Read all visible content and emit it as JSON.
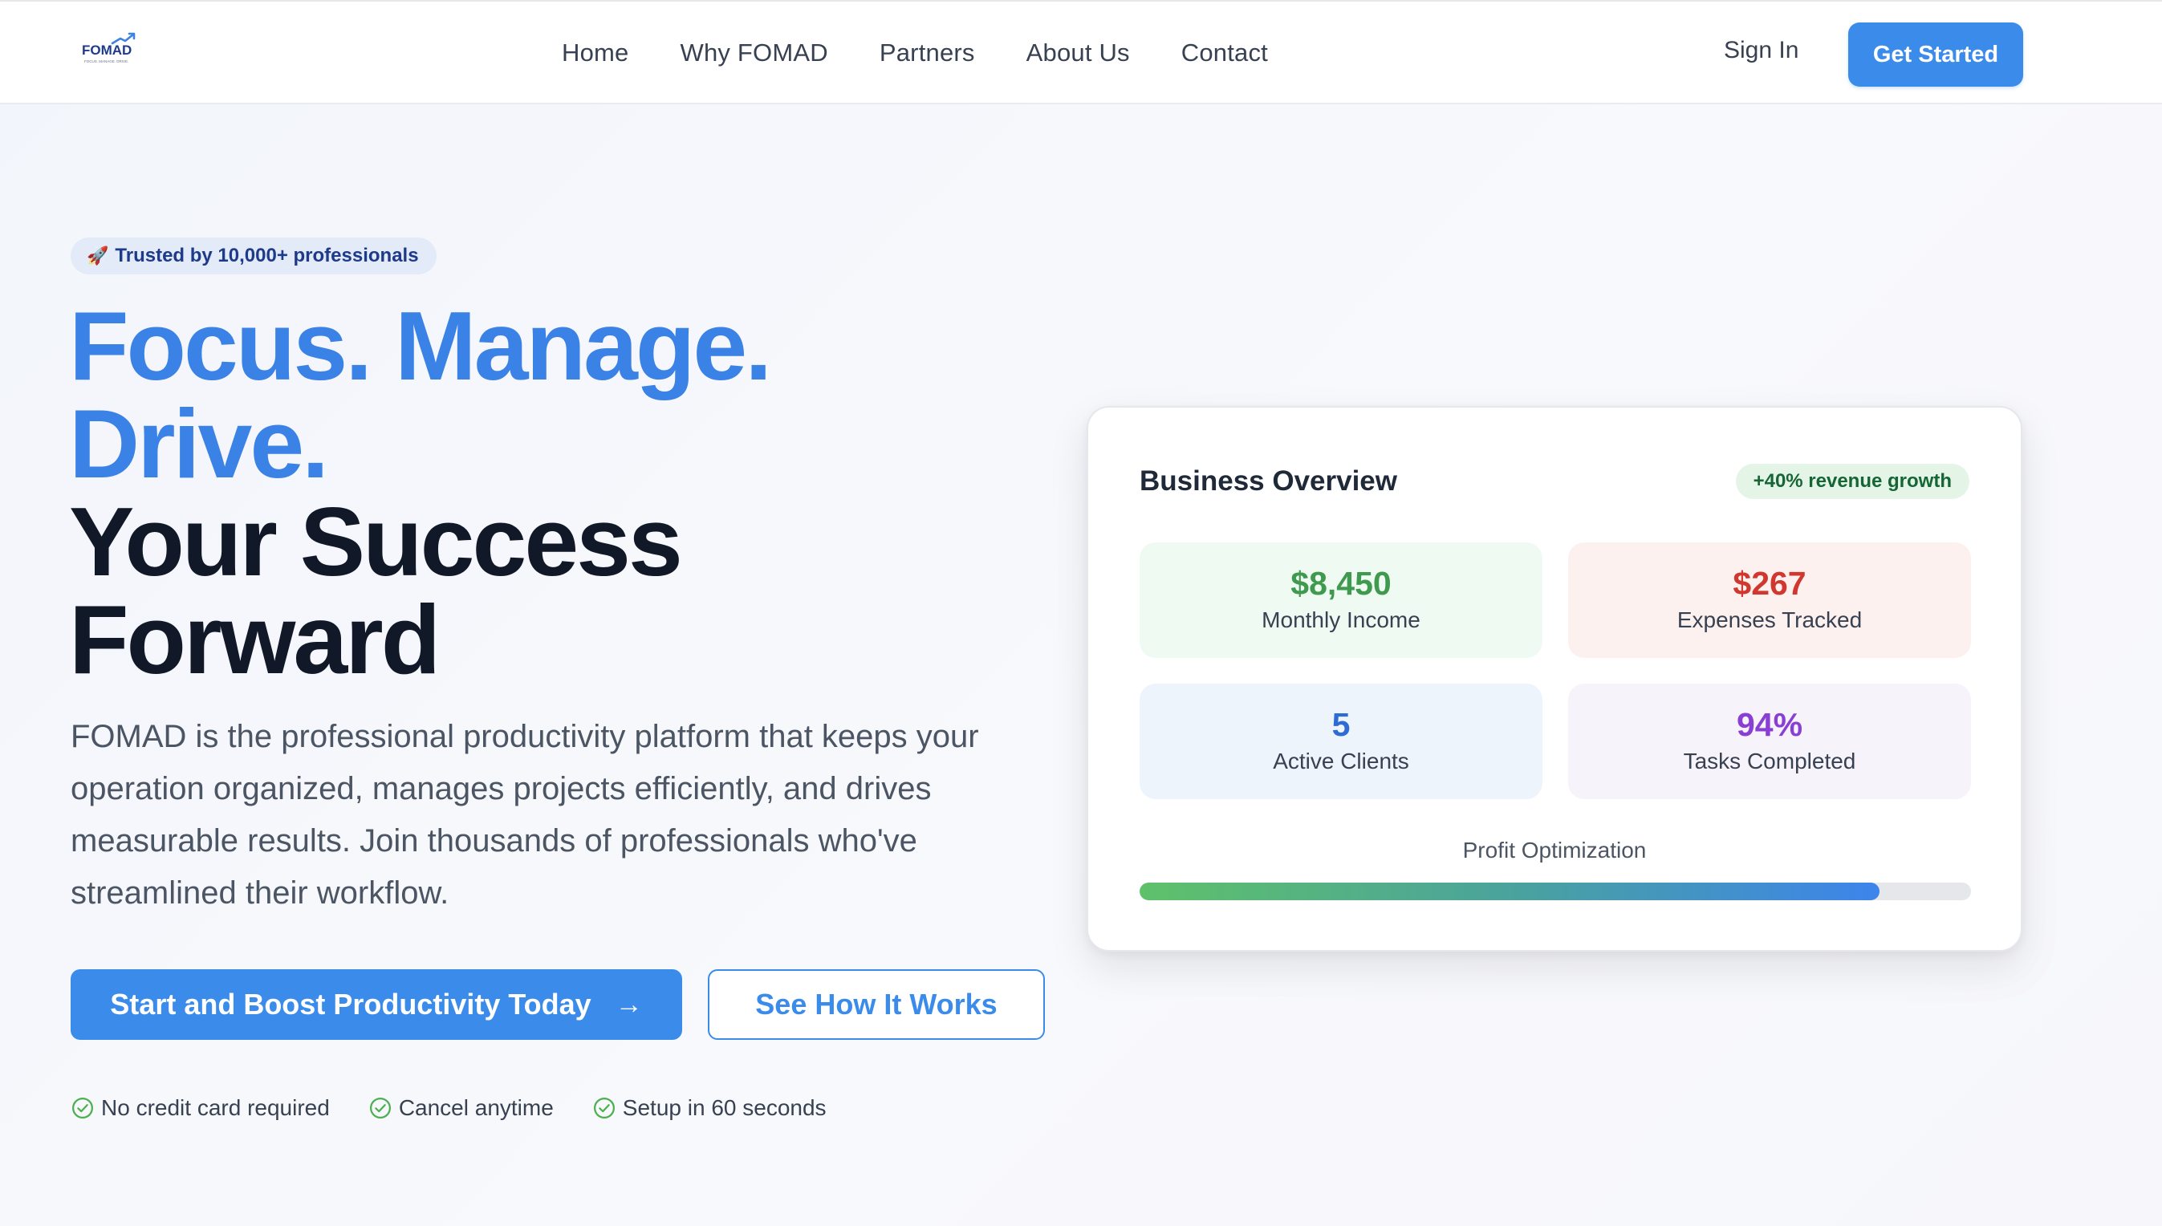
{
  "nav": {
    "logo_text": "FOMAD",
    "logo_tagline": "FOCUS. MANAGE. DRIVE.",
    "links": [
      "Home",
      "Why FOMAD",
      "Partners",
      "About Us",
      "Contact"
    ],
    "sign_in": "Sign In",
    "get_started": "Get Started"
  },
  "hero": {
    "badge_icon": "🚀",
    "badge": "Trusted by 10,000+ professionals",
    "headline_blue_1": "Focus. Manage.",
    "headline_blue_2": "Drive.",
    "headline_dark_1": "Your Success",
    "headline_dark_2": "Forward",
    "description": "FOMAD is the professional productivity platform that keeps your operation organized, manages projects efficiently, and drives measurable results. Join thousands of professionals who've streamlined their workflow.",
    "primary_cta": "Start and Boost Productivity Today",
    "primary_cta_arrow": "→",
    "secondary_cta": "See How It Works",
    "features": [
      "No credit card required",
      "Cancel anytime",
      "Setup in 60 seconds"
    ]
  },
  "dashboard": {
    "title": "Business Overview",
    "growth_badge": "+40% revenue growth",
    "stats": [
      {
        "value": "$8,450",
        "label": "Monthly Income"
      },
      {
        "value": "$267",
        "label": "Expenses Tracked"
      },
      {
        "value": "5",
        "label": "Active Clients"
      },
      {
        "value": "94%",
        "label": "Tasks Completed"
      }
    ],
    "profit_label": "Profit Optimization",
    "profit_progress_percent": 89
  },
  "colors": {
    "primary": "#3b8beb",
    "headline_blue": "#3b82e6",
    "income_green": "#3f9a4f",
    "expense_red": "#d0382f",
    "clients_blue": "#2f6bd4",
    "tasks_purple": "#8a3fd4",
    "check_green": "#4caf50"
  },
  "icons": {
    "logo": "fomad-logo-icon",
    "badge": "rocket-icon",
    "cta_arrow": "arrow-right-icon",
    "feature_check": "check-circle-icon"
  }
}
